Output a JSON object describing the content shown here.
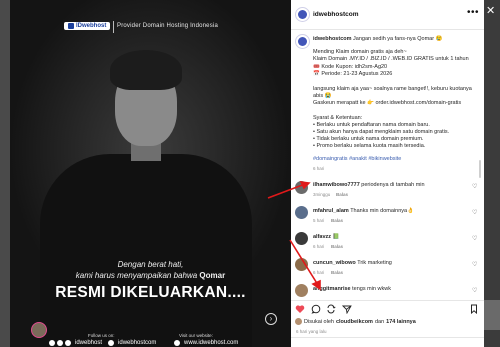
{
  "media": {
    "logo_text": "IDwebhost",
    "tagline": "Provider Domain Hosting Indonesia",
    "caption_line1": "Dengan berat hati,",
    "caption_line2_prefix": "kami harus menyampaikan bahwa ",
    "caption_line2_name": "Qomar",
    "headline": "RESMI DIKELUARKAN....",
    "follow_label": "Follow us on:",
    "visit_label": "Visit our website:",
    "social_handle_1": "idwebhost",
    "social_handle_2": "idwebhostcom",
    "website": "www.idwebhost.com",
    "next_icon": "chevron-right-icon"
  },
  "post": {
    "handle": "idwebhostcom",
    "caption_header_handle": "idwebhostcom",
    "caption_header_text": " Jangan sedih ya fans-nya Qomar 😢",
    "lines": [
      "Mending Klaim domain gratis aja deh~",
      "Klaim Domain .MY.ID / .BIZ.ID / .WEB.ID GRATIS untuk 1 tahun",
      "🎟️ Kode Kupon: idh2sm-Ag20",
      "📅 Periode: 21-23 Agustus 2026",
      "",
      "langsung klaim aja yaa~ soalnya rame banget!!, keburu kuotanya",
      "abis 😭",
      "Gaskeun merapatt ke 👉 order.idwebhost.com/domain-gratis",
      "",
      "Syarat & Ketentuan:",
      "• Berlaku untuk pendaftaran nama domain baru.",
      "• Satu akun hanya dapat mengklaim satu domain gratis.",
      "• Tidak berlaku untuk nama domain premium.",
      "• Promo berlaku selama kuota masih tersedia."
    ],
    "hashtags": "#domaingratis #anakit #bikinwebsite",
    "caption_time": "6 hari"
  },
  "comments": [
    {
      "user": "ilhamwibowo7777",
      "text": " periodenya di tambah min",
      "time": "3minggu",
      "reply": "Balas",
      "avatar_color": "#6b6b6b"
    },
    {
      "user": "mfahrul_alam",
      "text": " Thanks min domainnya👌",
      "time": "5 hari",
      "reply": "Balas",
      "avatar_color": "#5a6e8c"
    },
    {
      "user": "alfavzz",
      "text": " 📗",
      "time": "6 hari",
      "reply": "Balas",
      "avatar_color": "#3a3a3a"
    },
    {
      "user": "cuncun_wibowo",
      "text": " Trik marketing",
      "time": "6 hari",
      "reply": "Balas",
      "avatar_color": "#8c6c4a"
    },
    {
      "user": "anggitmanrise",
      "text": " tengs min wkwk",
      "time": "",
      "reply": "",
      "avatar_color": "#a08060"
    }
  ],
  "actions": {
    "like_icon": "heart-icon",
    "comment_icon": "comment-icon",
    "repost_icon": "repost-icon",
    "share_icon": "share-icon",
    "save_icon": "bookmark-icon",
    "like_color": "#ed4956"
  },
  "likes": {
    "prefix": "Disukai oleh ",
    "user": "cloudbeikcom",
    "middle": " dan ",
    "count": "174 lainnya"
  },
  "posted_time": "6 hari yang lalu",
  "close_icon": "close-icon",
  "more_icon": "more-horizontal-icon"
}
